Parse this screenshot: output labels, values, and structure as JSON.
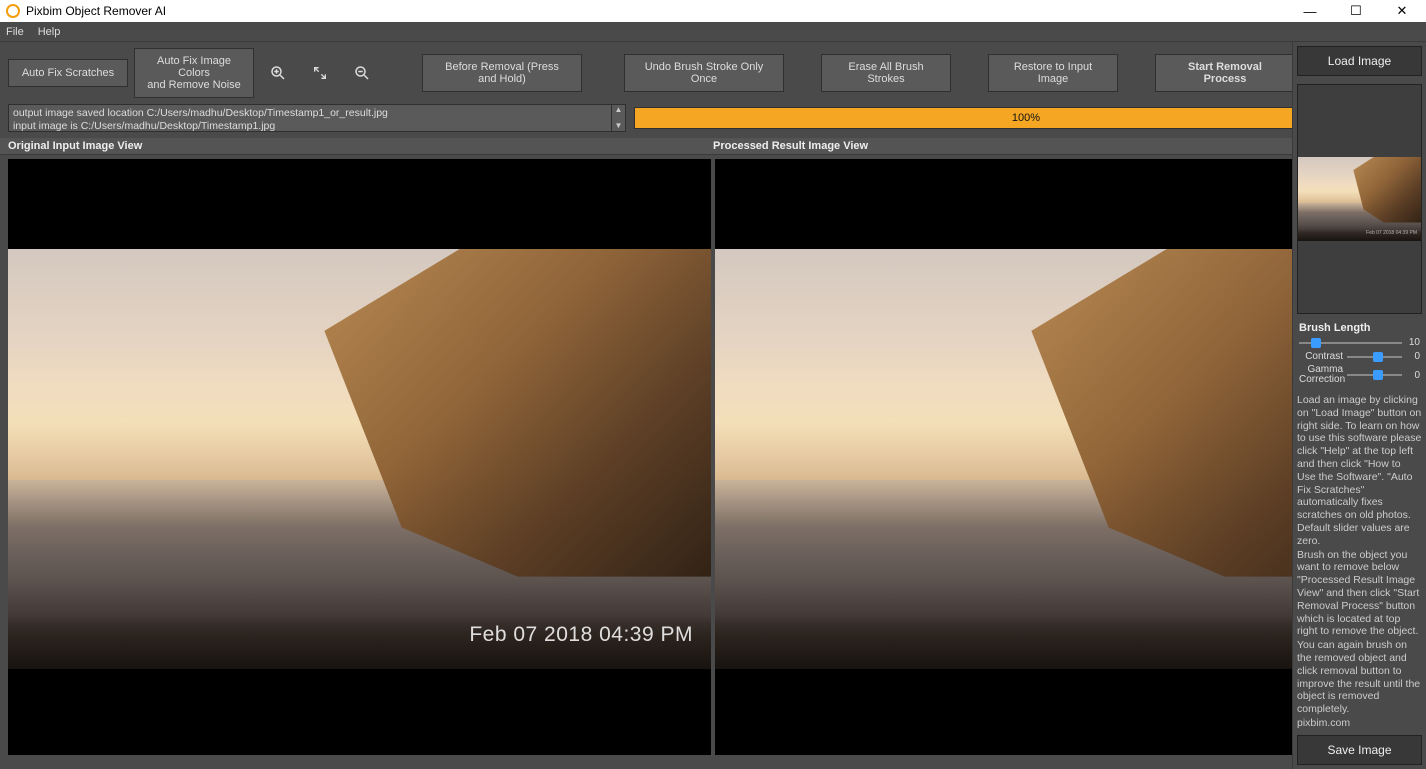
{
  "title": "Pixbim Object Remover AI",
  "menu": {
    "file": "File",
    "help": "Help"
  },
  "toolbar": {
    "autofix_scratches": "Auto Fix Scratches",
    "autofix_colors": "Auto Fix Image Colors\nand Remove Noise",
    "before_removal": "Before Removal (Press and Hold)",
    "undo_brush": "Undo Brush Stroke Only Once",
    "erase_all": "Erase All Brush Strokes",
    "restore": "Restore to Input Image",
    "start_removal": "Start Removal Process"
  },
  "log": {
    "line1": "output image saved location C:/Users/madhu/Desktop/Timestamp1_or_result.jpg",
    "line2": "input image is C:/Users/madhu/Desktop/Timestamp1.jpg"
  },
  "progress": {
    "percent": "100%"
  },
  "views": {
    "original": "Original Input Image View",
    "processed": "Processed Result Image View"
  },
  "timestamp": "Feb 07 2018 04:39 PM",
  "right": {
    "load": "Load Image",
    "save": "Save Image",
    "brush_length": "Brush Length",
    "brush_value": "10",
    "contrast_label": "Contrast",
    "contrast_value": "0",
    "gamma_label": "Gamma\nCorrection",
    "gamma_value": "0"
  },
  "help": {
    "p1": "Load an image by clicking on \"Load Image\" button on right side. To learn on how to use this software please click \"Help\" at the top left and then click \"How to Use the Software\". \"Auto Fix Scratches\" automatically fixes scratches on old photos. Default slider values are zero.",
    "p2": "Brush on the object you want to remove below \"Processed Result Image View\" and then click \"Start Removal Process\" button which is located at top right to remove the object.",
    "p3": " You can again brush on the removed object and click removal button to improve the result until the object is removed completely.",
    "p4": "pixbim.com"
  }
}
